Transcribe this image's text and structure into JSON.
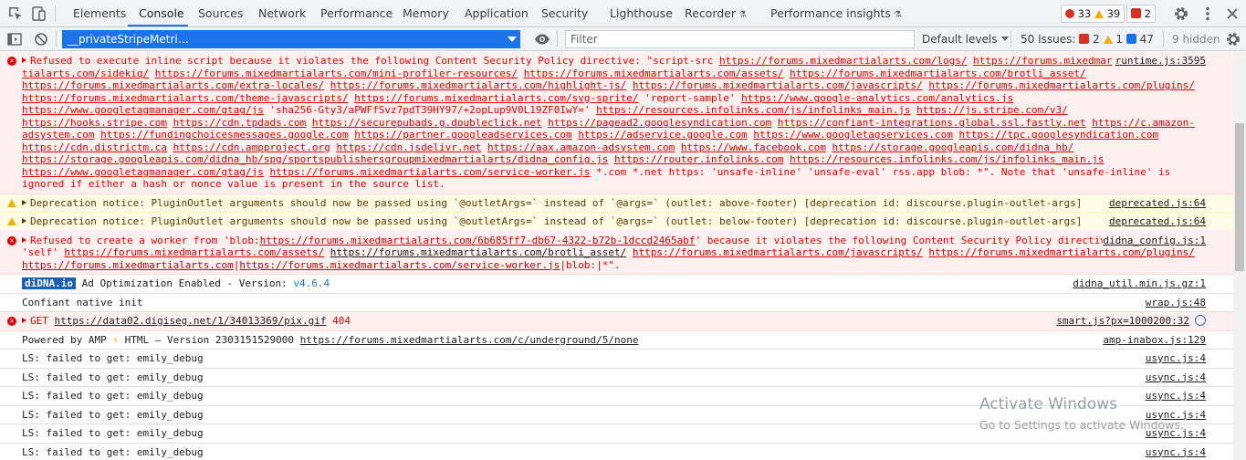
{
  "tabs": [
    {
      "label": "Elements"
    },
    {
      "label": "Console"
    },
    {
      "label": "Sources"
    },
    {
      "label": "Network"
    },
    {
      "label": "Performance"
    },
    {
      "label": "Memory"
    },
    {
      "label": "Application"
    },
    {
      "label": "Security"
    },
    {
      "label": "Lighthouse"
    },
    {
      "label": "Recorder"
    },
    {
      "label": "Performance insights"
    }
  ],
  "counters": {
    "errors": "33",
    "warnings": "39",
    "issues": "2"
  },
  "filterbar": {
    "context": "__privateStripeMetri…",
    "filter_placeholder": "Filter",
    "levels": "Default levels",
    "issues_label": "50 Issues:",
    "issues_err": "2",
    "issues_warn": "1",
    "issues_info": "47",
    "hidden": "9 hidden"
  },
  "messages": {
    "csp1": {
      "text_a": "Refused to execute inline script because it violates the following Content Security Policy directive: \"script-src ",
      "urls_a": [
        "https://forums.mixedmartialarts.com/logs/",
        "https://forums.mixedmar tialarts.com/sidekiq/",
        "https://forums.mixedmartialarts.com/mini-profiler-resources/",
        "https://forums.mixedmartialarts.com/assets/",
        "https://forums.mixedmartialarts.com/brotli_asset/",
        "https://forums.mixedmartialarts.com/extra-locales/",
        "https://forums.mixedmartialarts.com/highlight-js/",
        "https://forums.mixedmartialarts.com/javascripts/",
        "https://forums.mixedmartialarts.com/plugins/",
        "https://forums.mixedmartialarts.com/theme-javascripts/",
        "https://forums.mixedmartialarts.com/svg-sprite/"
      ],
      "text_b": " 'report-sample' ",
      "urls_b": [
        "https://www.google-analytics.com/analytics.js",
        "https://www.googletagmanager.com/gtag/js"
      ],
      "text_c": " 'sha256-Gty3/aPWFfSvz7pdT39HY97/+2opLup9V0L19ZF0IwY=' ",
      "urls_c": [
        "https://resources.infolinks.com/js/infolinks_main.js",
        "https://js.stripe.com/v3/",
        "https://hooks.stripe.com",
        "https://cdn.tpdads.com",
        "https://securepubads.g.doubleclick.net",
        "https://pagead2.googlesyndication.com",
        "https://confiant-integrations.global.ssl.fastly.net",
        "https://c.amazon-adsystem.com",
        "https://fundingchoicesmessages.google.com",
        "https://partner.googleadservices.com",
        "https://adservice.google.com",
        "https://www.googletagservices.com",
        "https://tpc.googlesyndication.com",
        "https://cdn.districtm.ca",
        "https://cdn.ampproject.org",
        "https://cdn.jsdelivr.net",
        "https://aax.amazon-adsystem.com",
        "https://www.facebook.com",
        "https://storage.googleapis.com/didna_hb/",
        "https://storage.googleapis.com/didna_hb/spg/sportspublishersgroupmixedmartialarts/didna_config.js",
        "https://router.infolinks.com",
        "https://resources.infolinks.com/js/infolinks_main.js",
        "https://www.googletagmanager.com/gtag/js",
        "https://forums.mixedmartialarts.com/service-worker.js"
      ],
      "text_d": " *.com *.net https: 'unsafe-inline' 'unsafe-eval' rss.app blob: *\". Note that 'unsafe-inline' is ignored if either a hash or nonce value is present in the source list.",
      "source": "runtime.js:3595"
    },
    "dep1": {
      "text": "Deprecation notice: PluginOutlet arguments should now be passed using `@outletArgs=` instead of `@args=` (outlet: above-footer) [deprecation id: discourse.plugin-outlet-args]",
      "source": "deprecated.js:64"
    },
    "dep2": {
      "text": "Deprecation notice: PluginOutlet arguments should now be passed using `@outletArgs=` instead of `@args=` (outlet: below-footer) [deprecation id: discourse.plugin-outlet-args]",
      "source": "deprecated.js:64"
    },
    "csp2": {
      "text_a": "Refused to create a worker from 'blob:",
      "blob_url": "https://forums.mixedmartialarts.com/6b685ff7-db67-4322-b72b-1dccd2465abf",
      "text_b": "' because it violates the following Content Security Policy directive: \"worker-src 'self' ",
      "url1": "https://forums.mixedmartialarts.com/assets/",
      "url2": "https://forums.mixedmartialarts.com/brotli_asset/",
      "url3": "https://forums.mixedmartialarts.com/javascripts/",
      "url4": "https://forums.mixedmartialarts.com/plugins/",
      "url5": "https://forums.mixedmartialarts.com",
      "url6": "https://forums.mixedmartialarts.com/service-worker.js",
      "text_c": "blob:|*\".",
      "source": "didna_config.js:1"
    },
    "didna": {
      "badge": "diDNA.io",
      "text": " Ad Optimization Enabled - Version: ",
      "version": "v4.6.4",
      "source": "didna_util.min.js.gz:1"
    },
    "confiant": {
      "text": "Confiant native init",
      "source": "wrap.js:48"
    },
    "get404": {
      "method": "GET",
      "url": "https://data02.digiseg.net/1/34013369/pix.gif",
      "status": "404",
      "source": "smart.js?px=1000200:32"
    },
    "amp": {
      "text_a": "Powered by AMP ",
      "bolt": "⚡",
      "text_b": " HTML – Version 2303151529000 ",
      "url": "https://forums.mixedmartialarts.com/c/underground/5/none",
      "source": "amp-inabox.js:129"
    },
    "ls": [
      {
        "text": "LS: failed to get: emily_debug",
        "source": "usync.js:4"
      },
      {
        "text": "LS: failed to get: emily_debug",
        "source": "usync.js:4"
      },
      {
        "text": "LS: failed to get: emily_debug",
        "source": "usync.js:4"
      },
      {
        "text": "LS: failed to get: emily_debug",
        "source": "usync.js:4"
      },
      {
        "text": "LS: failed to get: emily_debug",
        "source": "usync.js:4"
      },
      {
        "text": "LS: failed to get: emily_debug",
        "source": "usync.js:4"
      }
    ]
  },
  "watermark": {
    "line1": "Activate Windows",
    "line2": "Go to Settings to activate Windows."
  }
}
